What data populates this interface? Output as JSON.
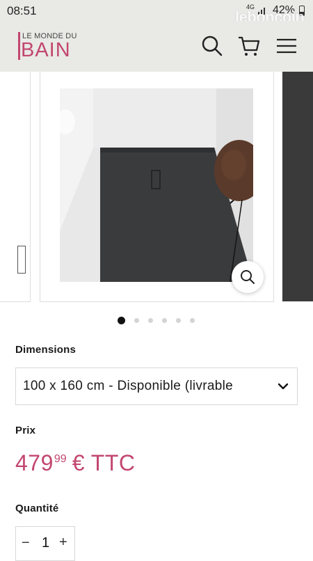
{
  "status": {
    "time": "08:51",
    "network": "4G",
    "battery": "42%"
  },
  "watermark": "leboncoin",
  "brand": {
    "top": "LE MONDE DU",
    "main": "BAIN"
  },
  "header_icons": [
    "search-icon",
    "cart-icon",
    "menu-icon"
  ],
  "carousel": {
    "slide_count": 6,
    "active_index": 0
  },
  "product": {
    "dimensions_label": "Dimensions",
    "dimensions_value": "100 x 160 cm - Disponible (livrable",
    "price_label": "Prix",
    "price_int": "479",
    "price_cents": "99",
    "price_suffix": "€ TTC",
    "quantity_label": "Quantité",
    "quantity_value": "1",
    "minus": "−",
    "plus": "+"
  },
  "colors": {
    "brand": "#c2476f",
    "header_bg": "#e9e9e6",
    "tray": "#3a3b3d"
  }
}
